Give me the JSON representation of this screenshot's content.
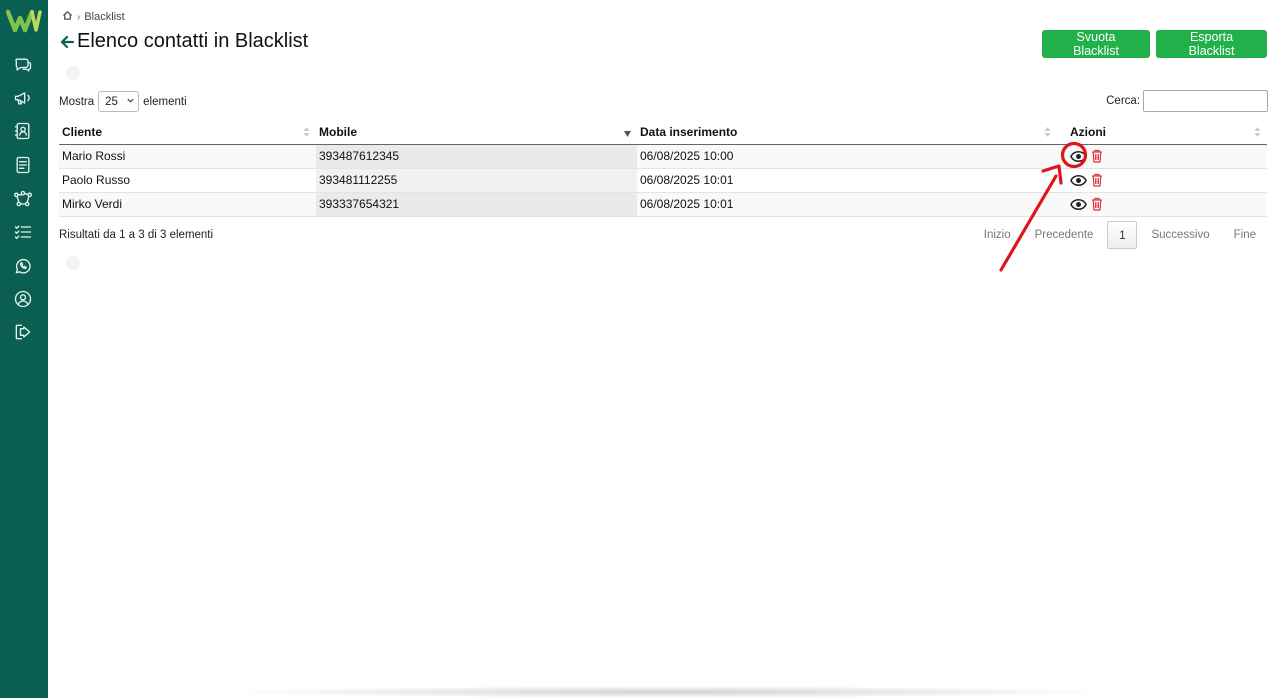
{
  "sidebar": {
    "items": [
      {
        "name": "chat-icon"
      },
      {
        "name": "megaphone-icon"
      },
      {
        "name": "contacts-icon"
      },
      {
        "name": "document-icon"
      },
      {
        "name": "flow-icon"
      },
      {
        "name": "checklist-icon"
      },
      {
        "name": "whatsapp-icon"
      },
      {
        "name": "user-icon"
      },
      {
        "name": "logout-icon"
      }
    ]
  },
  "breadcrumb": {
    "current": "Blacklist",
    "separator": "›"
  },
  "page": {
    "title": "Elenco contatti in Blacklist"
  },
  "actions": {
    "empty_label": "Svuota Blacklist",
    "export_label": "Esporta Blacklist"
  },
  "length": {
    "prefix": "Mostra",
    "value": "25",
    "suffix": "elementi"
  },
  "search": {
    "label": "Cerca:",
    "value": ""
  },
  "table": {
    "headers": {
      "cliente": "Cliente",
      "mobile": "Mobile",
      "data": "Data inserimento",
      "azioni": "Azioni"
    },
    "rows": [
      {
        "cliente": "Mario Rossi",
        "mobile": "393487612345",
        "data": "06/08/2025 10:00"
      },
      {
        "cliente": "Paolo Russo",
        "mobile": "393481112255",
        "data": "06/08/2025 10:01"
      },
      {
        "cliente": "Mirko Verdi",
        "mobile": "393337654321",
        "data": "06/08/2025 10:01"
      }
    ]
  },
  "info": "Risultati da 1 a 3 di 3 elementi",
  "pagination": {
    "first": "Inizio",
    "prev": "Precedente",
    "current": "1",
    "next": "Successivo",
    "last": "Fine"
  },
  "colors": {
    "sidebar": "#0b5e52",
    "button": "#22b04b",
    "annotation": "#e0141a",
    "trash": "#d9343a"
  }
}
